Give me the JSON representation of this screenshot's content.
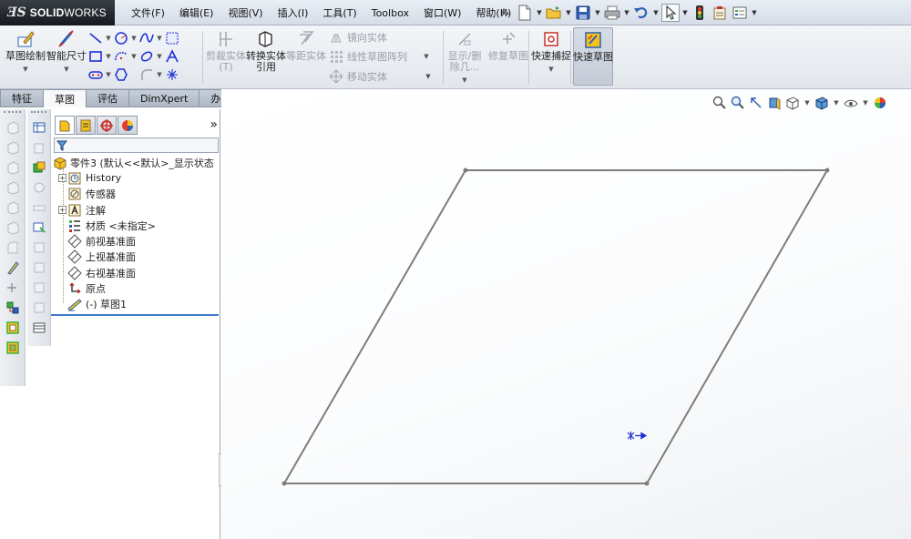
{
  "app": {
    "logo_ds": "ƎS",
    "logo_solid": "SOLID",
    "logo_works": "WORKS"
  },
  "menu": [
    "文件(F)",
    "编辑(E)",
    "视图(V)",
    "插入(I)",
    "工具(T)",
    "Toolbox",
    "窗口(W)",
    "帮助(H)"
  ],
  "quick_toolbar": {
    "icons": [
      "pin-icon",
      "new-document-icon",
      "open-folder-icon",
      "save-icon",
      "print-icon",
      "undo-icon",
      "select-arrow-icon",
      "rebuild-traffic-light-icon",
      "file-properties-icon",
      "options-icon"
    ]
  },
  "command_manager": {
    "sketch": "草图绘制",
    "smart_dimension": "智能尺寸",
    "trim": "剪裁实体(T)",
    "convert": "转换实体引用",
    "offset": "等距实体",
    "mirror": "镜向实体",
    "linear_pattern": "线性草图阵列",
    "move": "移动实体",
    "show_delete": "显示/删除几...",
    "repair": "修复草图",
    "quick_snap": "快速捕捉",
    "rapid_sketch": "快速草图"
  },
  "tabs": [
    {
      "label": "特征",
      "active": false
    },
    {
      "label": "草图",
      "active": true
    },
    {
      "label": "评估",
      "active": false
    },
    {
      "label": "DimXpert",
      "active": false
    },
    {
      "label": "办公室产品",
      "active": false
    }
  ],
  "feature_manager": {
    "expand_symbol": "»",
    "root": "零件3 (默认<<默认>_显示状态",
    "items": [
      {
        "label": "History",
        "icon": "history-icon",
        "expandable": true
      },
      {
        "label": "传感器",
        "icon": "sensor-icon",
        "expandable": false
      },
      {
        "label": "注解",
        "icon": "annotation-icon",
        "expandable": true
      },
      {
        "label": "材质 <未指定>",
        "icon": "material-icon",
        "expandable": false
      },
      {
        "label": "前视基准面",
        "icon": "plane-icon",
        "expandable": false
      },
      {
        "label": "上视基准面",
        "icon": "plane-icon",
        "expandable": false
      },
      {
        "label": "右视基准面",
        "icon": "plane-icon",
        "expandable": false
      },
      {
        "label": "原点",
        "icon": "origin-icon",
        "expandable": false
      },
      {
        "label": "(-) 草图1",
        "icon": "sketch-icon",
        "expandable": false
      }
    ]
  },
  "colors": {
    "accent_blue": "#3d7ac7",
    "sketch_line": "#7d7d7d",
    "origin": "#1c2fd9"
  }
}
